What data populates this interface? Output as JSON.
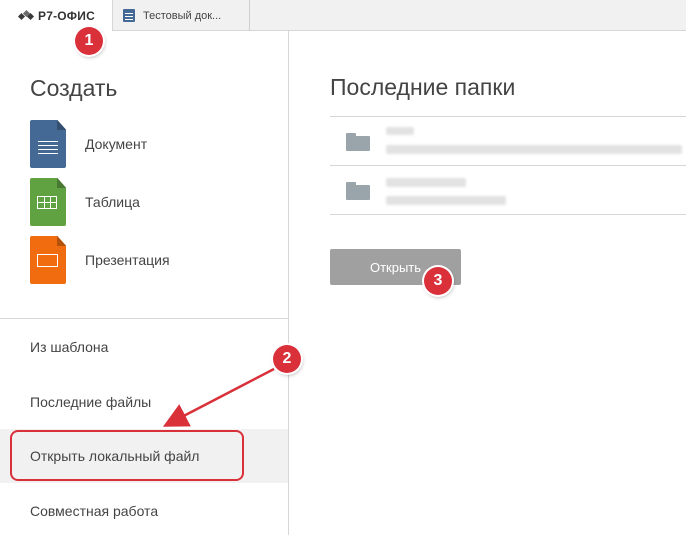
{
  "tabs": {
    "home_label": "Р7-ОФИС",
    "document_label": "Тестовый док..."
  },
  "sidebar": {
    "create_title": "Создать",
    "create_items": [
      {
        "label": "Документ",
        "icon": "document-icon",
        "color": "#446995"
      },
      {
        "label": "Таблица",
        "icon": "spreadsheet-icon",
        "color": "#60a142"
      },
      {
        "label": "Презентация",
        "icon": "presentation-icon",
        "color": "#f06c0f"
      }
    ],
    "menu_items": [
      {
        "label": "Из шаблона"
      },
      {
        "label": "Последние файлы"
      },
      {
        "label": "Открыть локальный файл"
      },
      {
        "label": "Совместная работа"
      }
    ]
  },
  "main": {
    "title": "Последние папки",
    "open_button": "Открыть"
  },
  "annotations": {
    "badges": [
      "1",
      "2",
      "3"
    ],
    "color": "#d9303a"
  }
}
